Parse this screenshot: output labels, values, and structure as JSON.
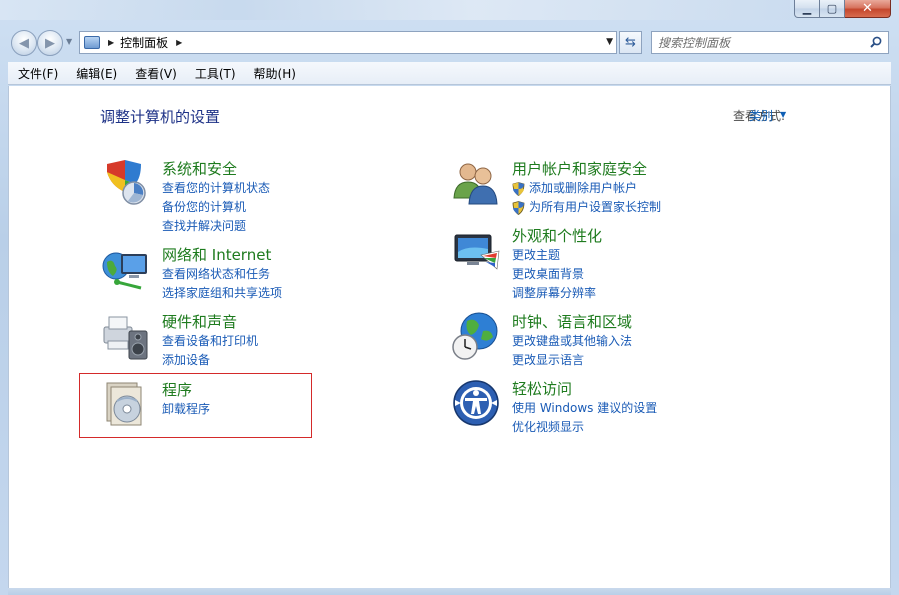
{
  "window": {
    "caption_min": "▁",
    "caption_max": "▢",
    "caption_close": "✕"
  },
  "nav": {
    "breadcrumb": "控制面板",
    "search_placeholder": "搜索控制面板"
  },
  "menu": [
    "文件(F)",
    "编辑(E)",
    "查看(V)",
    "工具(T)",
    "帮助(H)"
  ],
  "main": {
    "title": "调整计算机的设置",
    "view_by_label": "查看方式:",
    "view_by_value": "类别"
  },
  "categories": [
    {
      "title": "系统和安全",
      "icon": "system-security-icon",
      "links": [
        "查看您的计算机状态",
        "备份您的计算机",
        "查找并解决问题"
      ]
    },
    {
      "title": "网络和 Internet",
      "icon": "network-internet-icon",
      "links": [
        "查看网络状态和任务",
        "选择家庭组和共享选项"
      ]
    },
    {
      "title": "硬件和声音",
      "icon": "hardware-sound-icon",
      "links": [
        "查看设备和打印机",
        "添加设备"
      ]
    },
    {
      "title": "程序",
      "icon": "programs-icon",
      "links": [
        "卸载程序"
      ]
    },
    {
      "title": "用户帐户和家庭安全",
      "icon": "user-accounts-icon",
      "links": [
        "添加或删除用户帐户",
        "为所有用户设置家长控制"
      ]
    },
    {
      "title": "外观和个性化",
      "icon": "appearance-icon",
      "links": [
        "更改主题",
        "更改桌面背景",
        "调整屏幕分辨率"
      ]
    },
    {
      "title": "时钟、语言和区域",
      "icon": "clock-language-icon",
      "links": [
        "更改键盘或其他输入法",
        "更改显示语言"
      ]
    },
    {
      "title": "轻松访问",
      "icon": "ease-of-access-icon",
      "links": [
        "使用 Windows 建议的设置",
        "优化视频显示"
      ]
    }
  ],
  "colors": {
    "category_title": "#1e7b1e",
    "link": "#1a5bb6",
    "page_title": "#1e3287",
    "highlight_border": "#d42a2a"
  }
}
